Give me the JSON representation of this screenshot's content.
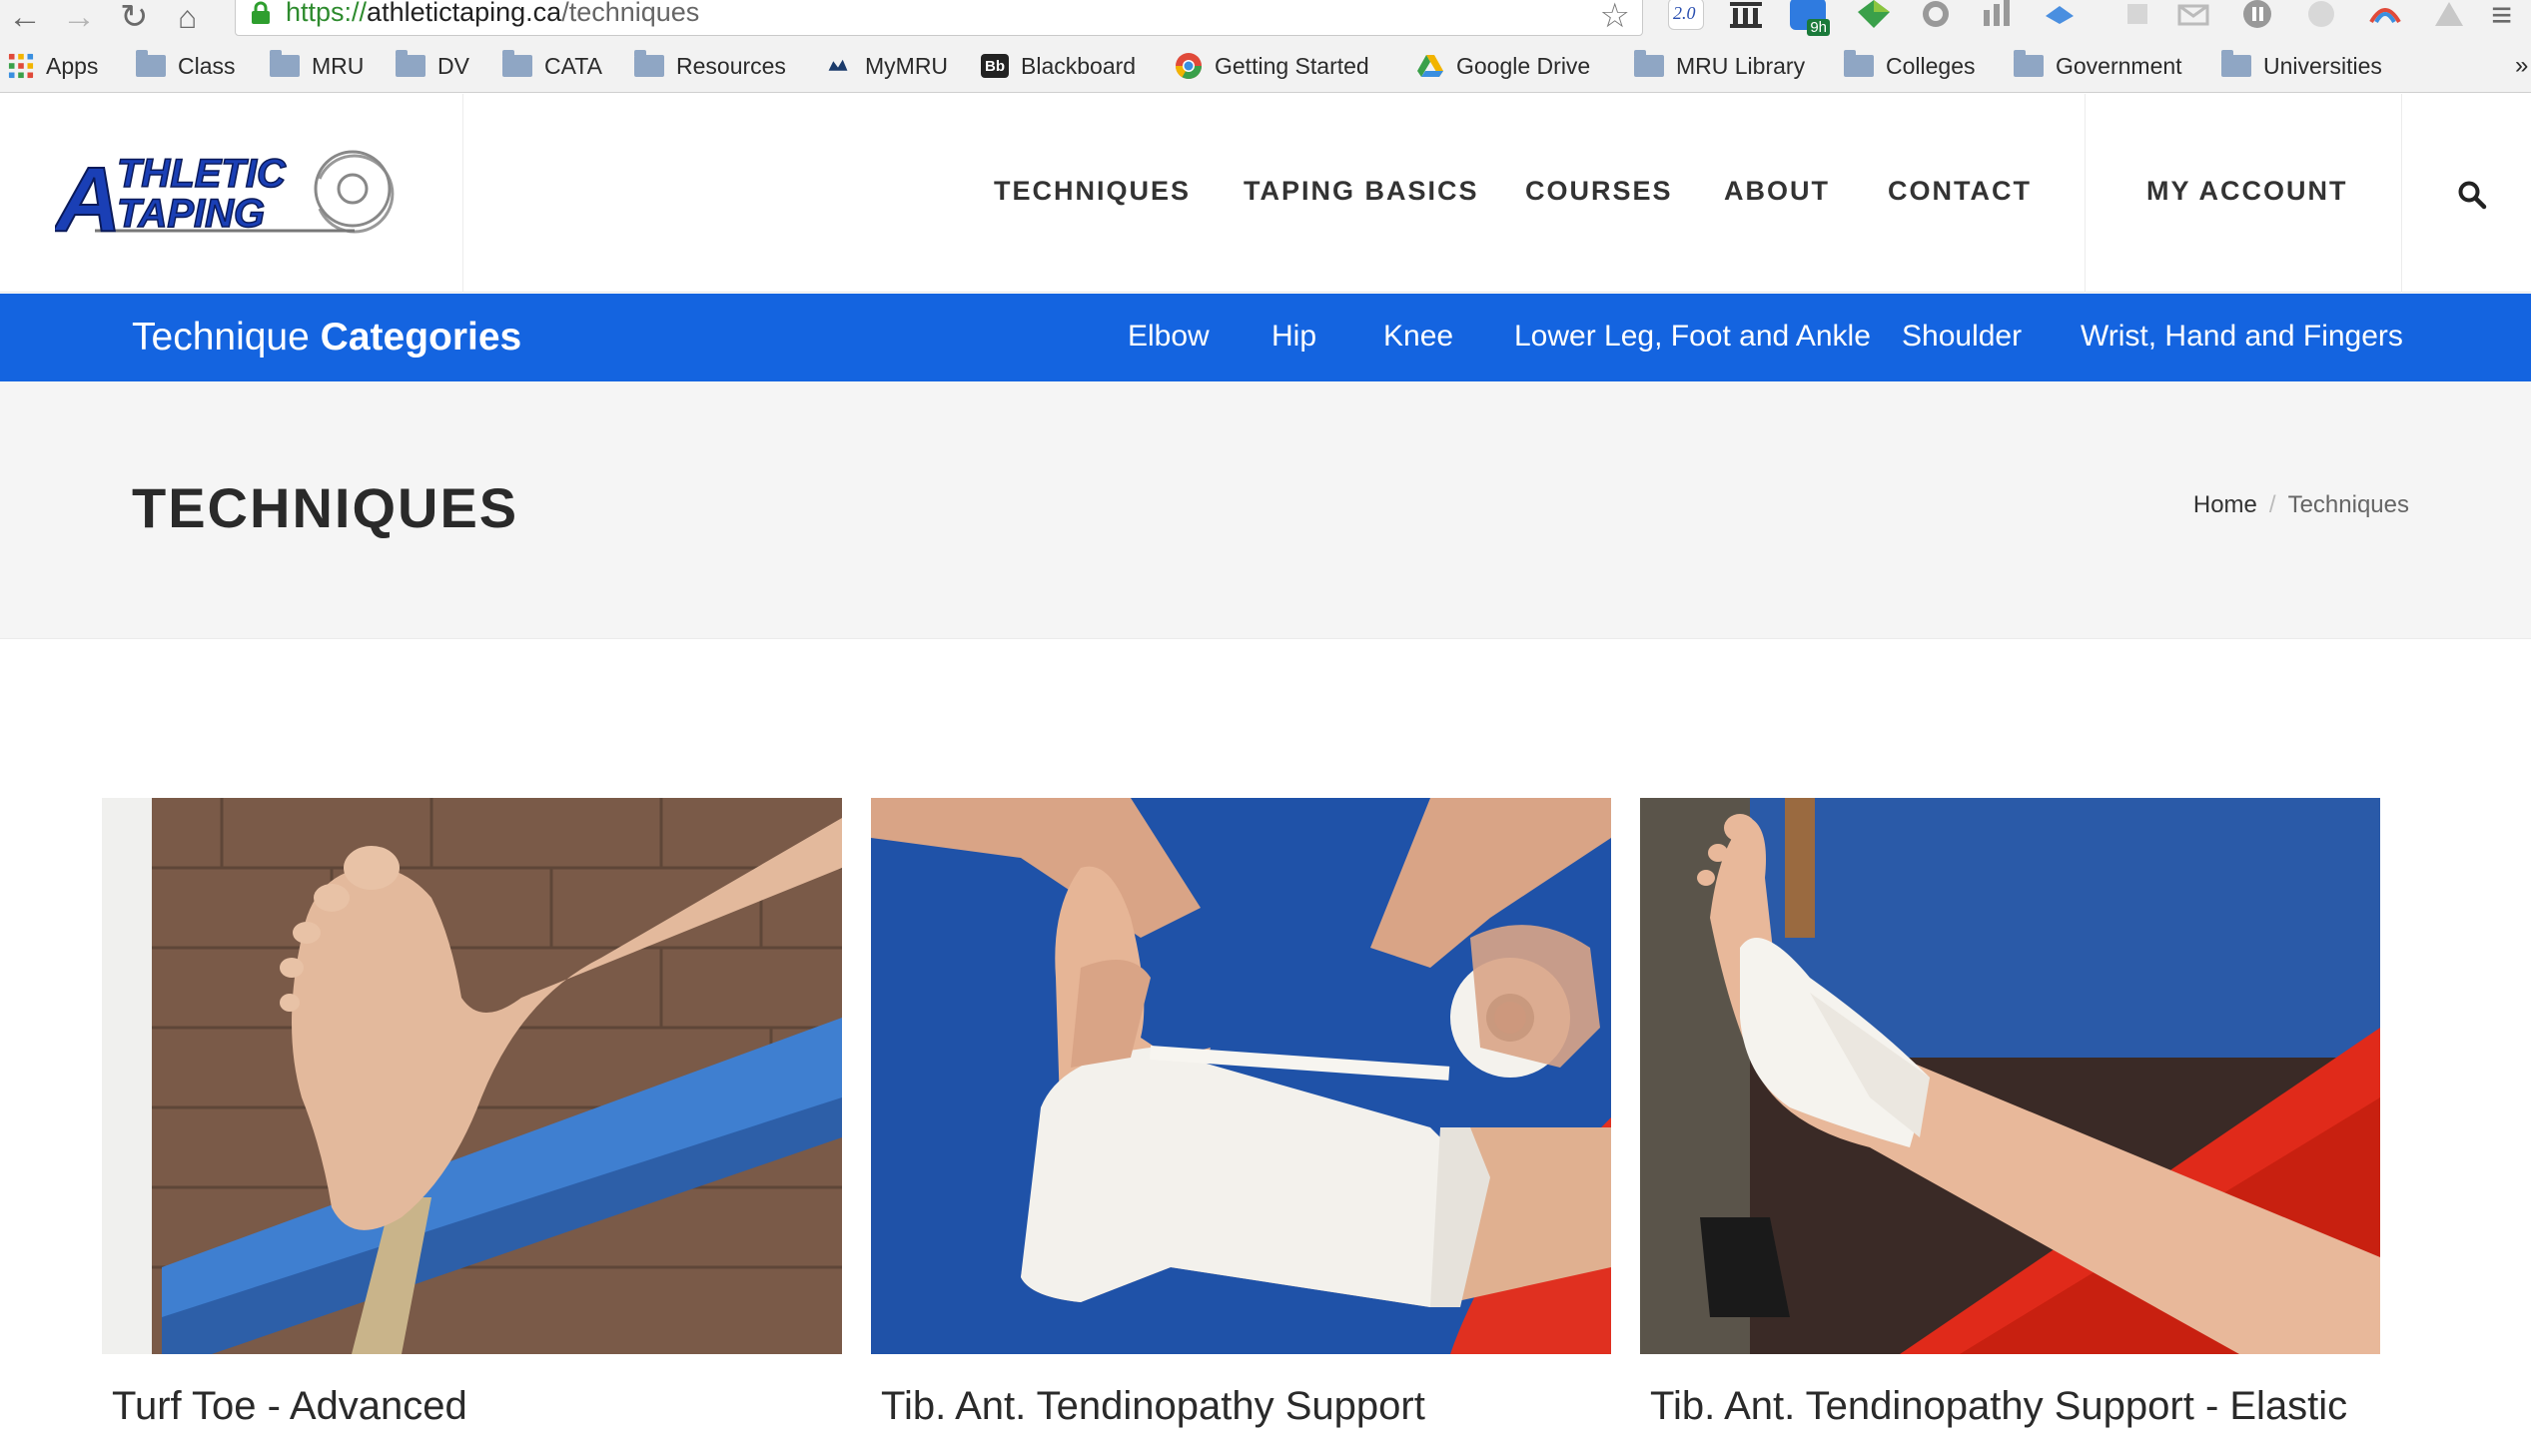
{
  "browser": {
    "url_scheme": "https://",
    "url_host": "athletictaping.ca",
    "url_path": "/techniques",
    "ext_badge": "9h",
    "ext_version_label": "2.0",
    "bookmarks": [
      {
        "label": "Apps",
        "icon": "apps-grid-icon"
      },
      {
        "label": "Class",
        "icon": "folder-icon"
      },
      {
        "label": "MRU",
        "icon": "folder-icon"
      },
      {
        "label": "DV",
        "icon": "folder-icon"
      },
      {
        "label": "CATA",
        "icon": "folder-icon"
      },
      {
        "label": "Resources",
        "icon": "folder-icon"
      },
      {
        "label": "MyMRU",
        "icon": "mymru-icon"
      },
      {
        "label": "Blackboard",
        "icon": "blackboard-icon"
      },
      {
        "label": "Getting Started",
        "icon": "chrome-icon"
      },
      {
        "label": "Google Drive",
        "icon": "drive-icon"
      },
      {
        "label": "MRU Library",
        "icon": "folder-icon"
      },
      {
        "label": "Colleges",
        "icon": "folder-icon"
      },
      {
        "label": "Government",
        "icon": "folder-icon"
      },
      {
        "label": "Universities",
        "icon": "folder-icon"
      }
    ],
    "overflow_label": "»"
  },
  "header": {
    "logo_line1": "THLETIC",
    "logo_line2": "TAPING",
    "logo_letter": "A",
    "nav": [
      "TECHNIQUES",
      "TAPING BASICS",
      "COURSES",
      "ABOUT",
      "CONTACT"
    ],
    "account": "MY ACCOUNT"
  },
  "categories": {
    "title_light": "Technique",
    "title_bold": "Categories",
    "links": [
      "Elbow",
      "Hip",
      "Knee",
      "Lower Leg, Foot and Ankle",
      "Shoulder",
      "Wrist, Hand and Fingers"
    ]
  },
  "page": {
    "title": "TECHNIQUES",
    "breadcrumb_home": "Home",
    "breadcrumb_sep": "/",
    "breadcrumb_current": "Techniques"
  },
  "cards": [
    {
      "title": "Turf Toe - Advanced"
    },
    {
      "title": "Tib. Ant. Tendinopathy Support"
    },
    {
      "title": "Tib. Ant. Tendinopathy Support - Elastic"
    }
  ],
  "colors": {
    "brand_blue": "#1464e0",
    "logo_blue": "#1a3fb5"
  }
}
